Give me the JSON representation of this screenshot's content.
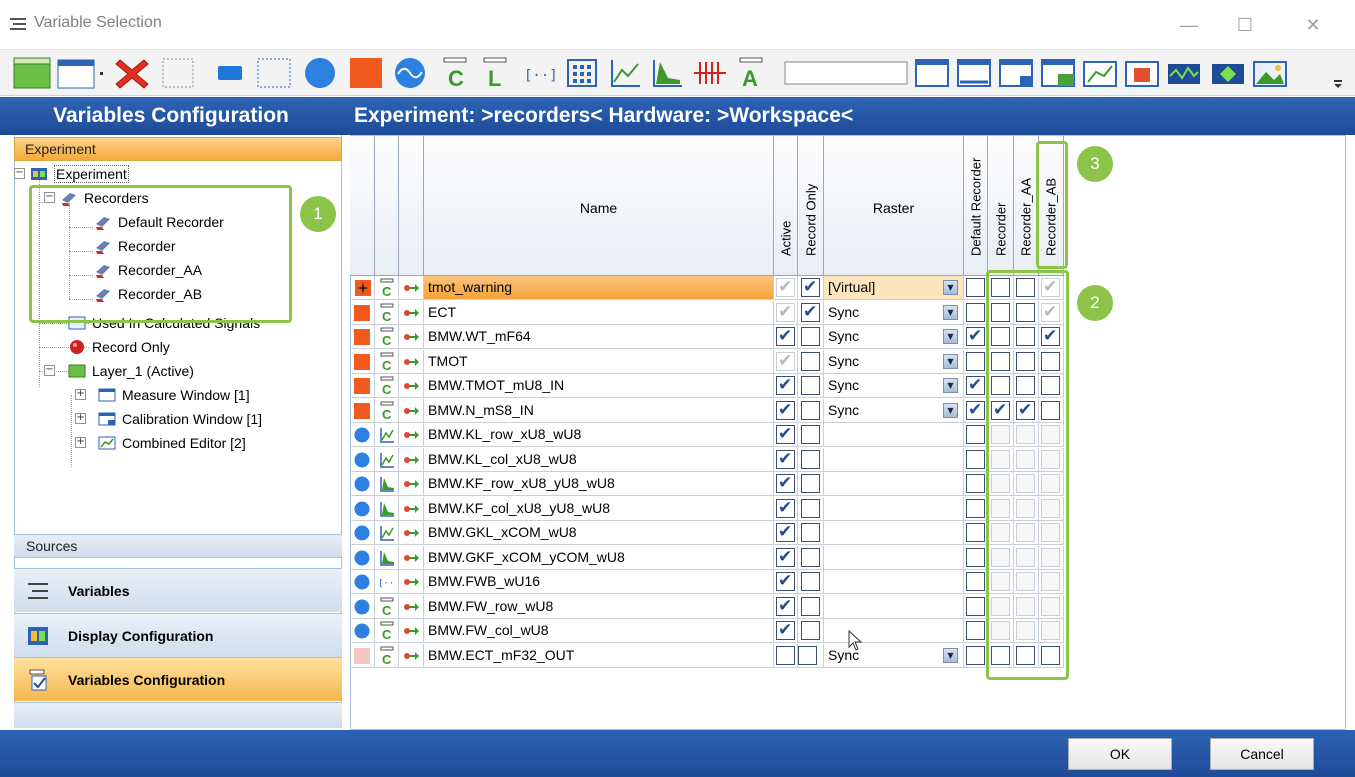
{
  "window": {
    "title": "Variable Selection",
    "minimize": "—",
    "maximize": "☐",
    "close": "✕"
  },
  "left_panel": {
    "header": "Variables Configuration",
    "experiment_bar": "Experiment",
    "tree": {
      "experiment": "Experiment",
      "recorders": "Recorders",
      "default_recorder": "Default Recorder",
      "recorder": "Recorder",
      "recorder_aa": "Recorder_AA",
      "recorder_ab": "Recorder_AB",
      "used_in_calc": "Used In Calculated Signals",
      "record_only": "Record Only",
      "layer": "Layer_1 (Active)",
      "measure_window": "Measure Window [1]",
      "calibration_window": "Calibration Window [1]",
      "combined_editor": "Combined Editor [2]"
    },
    "sources": "Sources",
    "nav": {
      "variables": "Variables",
      "display_configuration": "Display Configuration",
      "variables_configuration": "Variables Configuration"
    }
  },
  "right_panel": {
    "header": "Experiment: >recorders< Hardware: >Workspace<",
    "columns": {
      "name": "Name",
      "active": "Active",
      "record_only": "Record Only",
      "raster": "Raster",
      "default_recorder": "Default Recorder",
      "recorder": "Recorder",
      "recorder_aa": "Recorder_AA",
      "recorder_ab": "Recorder_AB"
    },
    "rows": [
      {
        "name": "tmot_warning",
        "raster": "[Virtual]",
        "active": "grey",
        "record_only": "on",
        "default": "",
        "rec": "",
        "aa": "",
        "ab": "grey"
      },
      {
        "name": "ECT",
        "raster": "Sync",
        "active": "grey",
        "record_only": "on",
        "default": "",
        "rec": "",
        "aa": "",
        "ab": "grey"
      },
      {
        "name": "BMW.WT_mF64",
        "raster": "Sync",
        "active": "on",
        "record_only": "",
        "default": "on",
        "rec": "",
        "aa": "",
        "ab": "on"
      },
      {
        "name": "TMOT",
        "raster": "Sync",
        "active": "grey",
        "record_only": "",
        "default": "",
        "rec": "",
        "aa": "",
        "ab": ""
      },
      {
        "name": "BMW.TMOT_mU8_IN",
        "raster": "Sync",
        "active": "on",
        "record_only": "",
        "default": "on",
        "rec": "",
        "aa": "",
        "ab": ""
      },
      {
        "name": "BMW.N_mS8_IN",
        "raster": "Sync",
        "active": "on",
        "record_only": "",
        "default": "on",
        "rec": "on",
        "aa": "on",
        "ab": ""
      },
      {
        "name": "BMW.KL_row_xU8_wU8",
        "raster": "",
        "active": "on",
        "record_only": "",
        "default": "",
        "rec": "",
        "aa": "",
        "ab": ""
      },
      {
        "name": "BMW.KL_col_xU8_wU8",
        "raster": "",
        "active": "on",
        "record_only": "",
        "default": "",
        "rec": "",
        "aa": "",
        "ab": ""
      },
      {
        "name": "BMW.KF_row_xU8_yU8_wU8",
        "raster": "",
        "active": "on",
        "record_only": "",
        "default": "",
        "rec": "",
        "aa": "",
        "ab": ""
      },
      {
        "name": "BMW.KF_col_xU8_yU8_wU8",
        "raster": "",
        "active": "on",
        "record_only": "",
        "default": "",
        "rec": "",
        "aa": "",
        "ab": ""
      },
      {
        "name": "BMW.GKL_xCOM_wU8",
        "raster": "",
        "active": "on",
        "record_only": "",
        "default": "",
        "rec": "",
        "aa": "",
        "ab": ""
      },
      {
        "name": "BMW.GKF_xCOM_yCOM_wU8",
        "raster": "",
        "active": "on",
        "record_only": "",
        "default": "",
        "rec": "",
        "aa": "",
        "ab": ""
      },
      {
        "name": "BMW.FWB_wU16",
        "raster": "",
        "active": "on",
        "record_only": "",
        "default": "",
        "rec": "",
        "aa": "",
        "ab": ""
      },
      {
        "name": "BMW.FW_row_wU8",
        "raster": "",
        "active": "on",
        "record_only": "",
        "default": "",
        "rec": "",
        "aa": "",
        "ab": ""
      },
      {
        "name": "BMW.FW_col_wU8",
        "raster": "",
        "active": "on",
        "record_only": "",
        "default": "",
        "rec": "",
        "aa": "",
        "ab": ""
      },
      {
        "name": "BMW.ECT_mF32_OUT",
        "raster": "Sync",
        "active": "",
        "record_only": "",
        "default": "",
        "rec": "",
        "aa": "",
        "ab": ""
      }
    ]
  },
  "callouts": {
    "one": "1",
    "two": "2",
    "three": "3"
  },
  "buttons": {
    "ok": "OK",
    "cancel": "Cancel"
  },
  "colors": {
    "header_blue": "#1e4b98",
    "accent_orange": "#f5a93a",
    "callout_green": "#8cc44a",
    "check_blue": "#1f4f8f"
  }
}
